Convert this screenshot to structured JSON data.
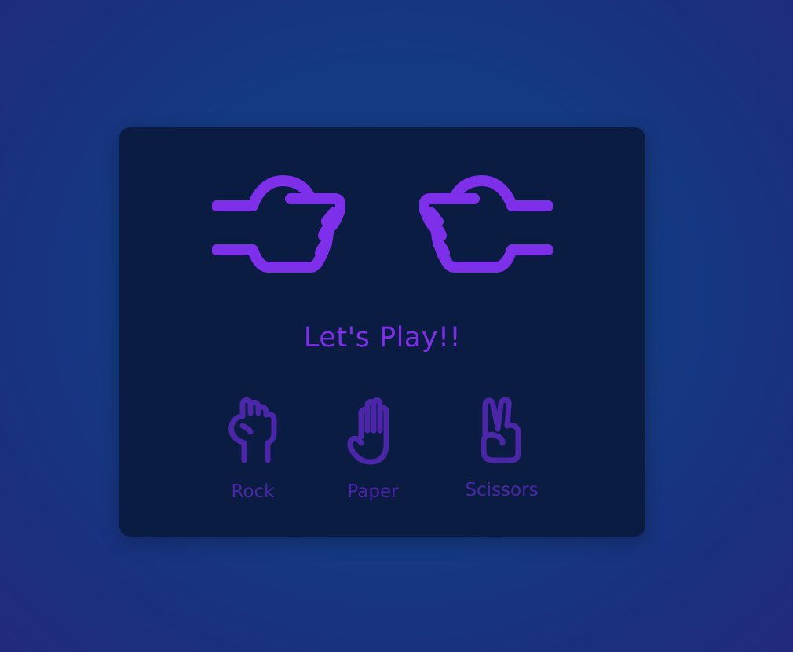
{
  "game": {
    "status_text": "Let's Play!!",
    "player_hand_icon": "rock-hand-icon",
    "computer_hand_icon": "rock-hand-icon"
  },
  "choices": [
    {
      "label": "Rock",
      "icon": "rock-icon"
    },
    {
      "label": "Paper",
      "icon": "paper-icon"
    },
    {
      "label": "Scissors",
      "icon": "scissors-icon"
    }
  ],
  "colors": {
    "background": "#143a82",
    "card": "#0b1c42",
    "accent": "#7e2fe9",
    "choice": "#4b26a8"
  }
}
